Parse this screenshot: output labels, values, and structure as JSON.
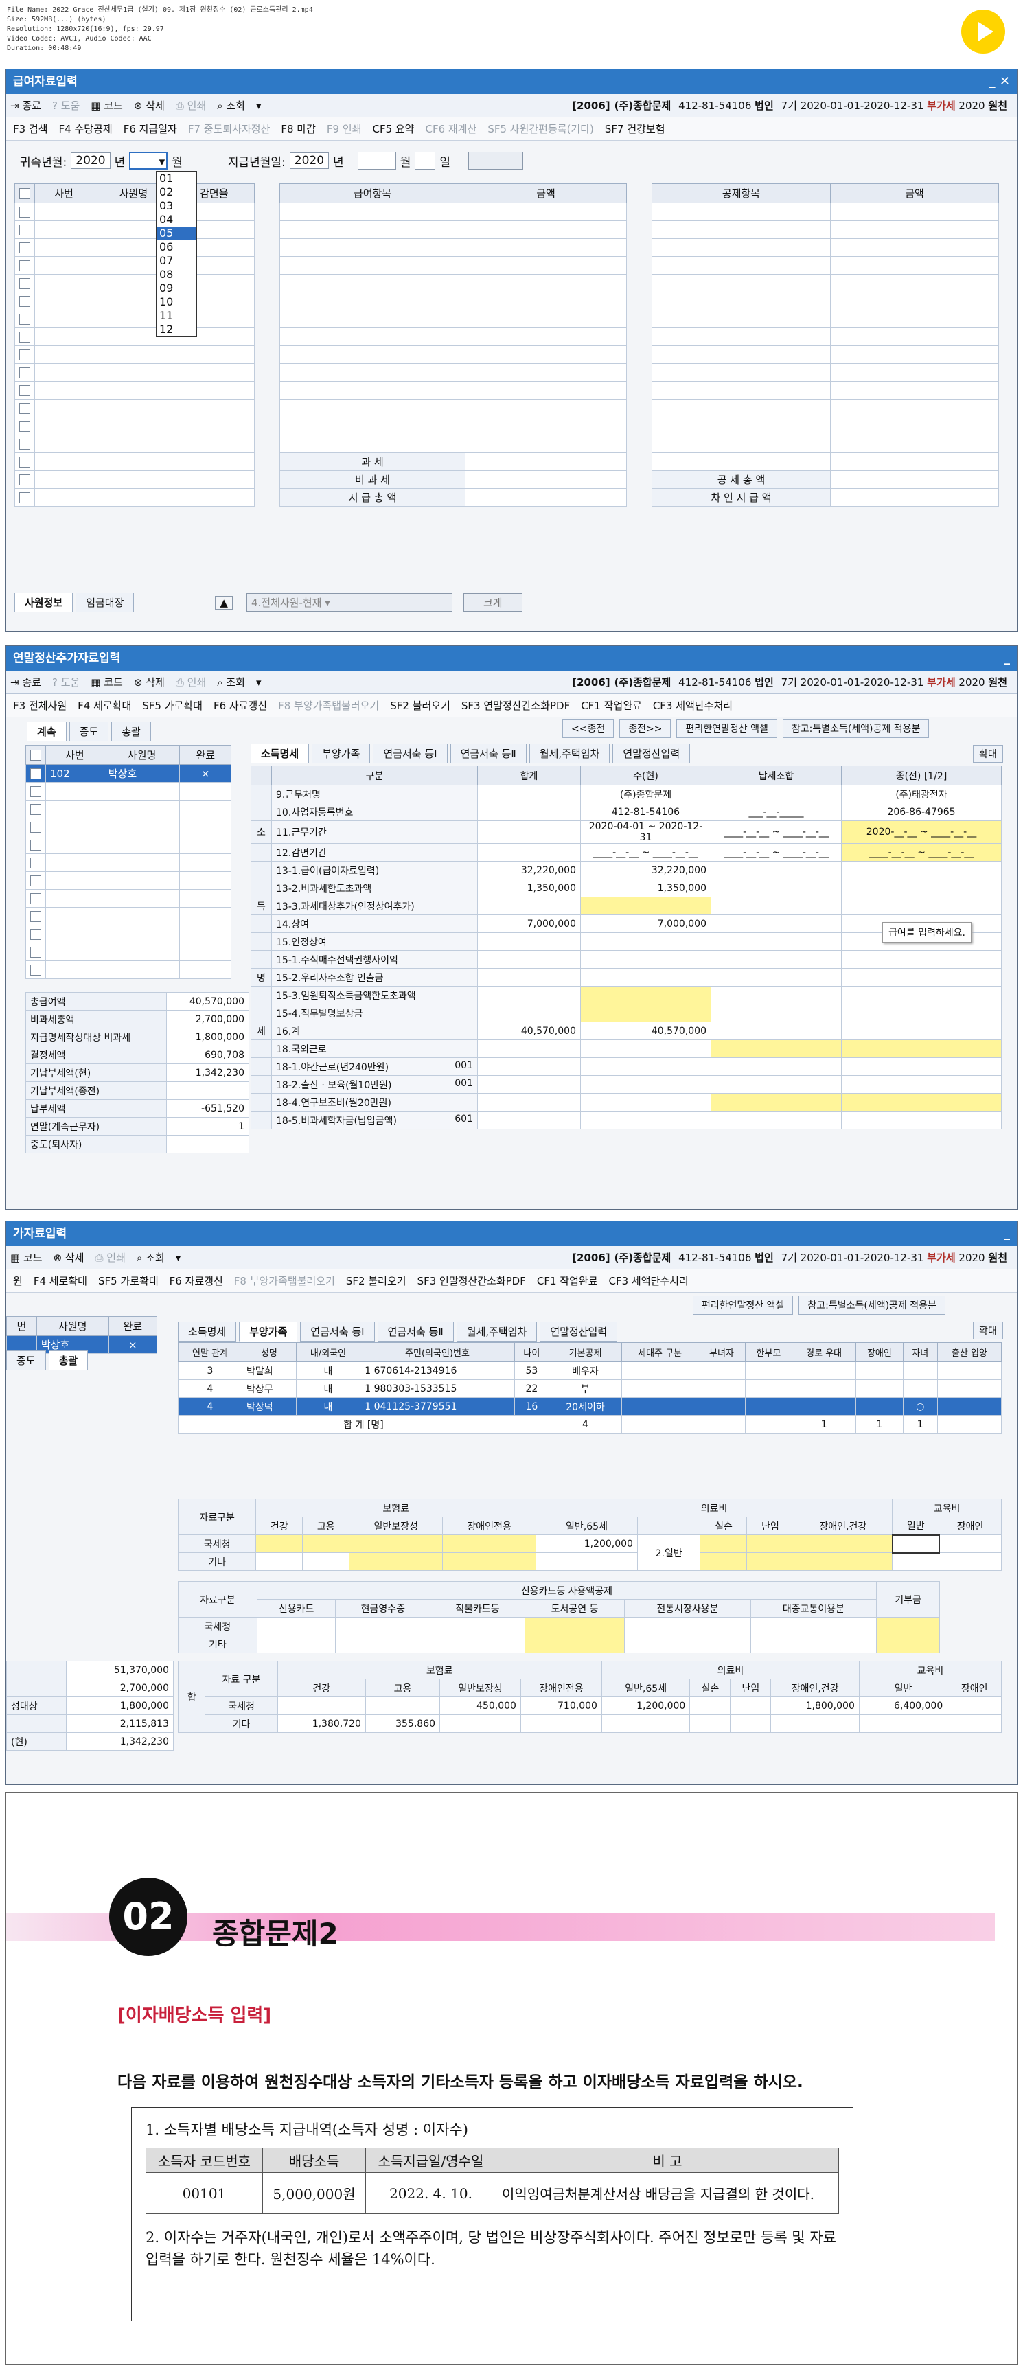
{
  "meta": {
    "lines": [
      "File Name: 2022 Grace 전산세무1급 (실기) 09. 제1장 원천징수 (02) 근로소득관리 2.mp4",
      "Size: 592MB(...) (bytes)",
      "Resolution: 1280x720(16:9), fps: 29.97",
      "Video Codec: AVC1, Audio Codec: AAC",
      "Duration: 00:48:49"
    ]
  },
  "company": {
    "code": "[2006]",
    "name": "(주)종합문제",
    "bizno": "412-81-54106",
    "type": "법인",
    "term": "7기",
    "period": "2020-01-01-2020-12-31",
    "vat": "부가세",
    "year": "2020",
    "tag": "원천"
  },
  "win1": {
    "title": "급여자료입력",
    "toolbar": [
      "종료",
      "도움",
      "코드",
      "삭제",
      "인쇄",
      "조회"
    ],
    "fkeys": [
      "F3 검색",
      "F4 수당공제",
      "F6 지급일자",
      "F7 중도퇴사자정산",
      "F8 마감",
      "F9 인쇄",
      "CF5 요약",
      "CF6 재계산",
      "SF5 사원간편등록(기타)",
      "SF7 건강보험"
    ],
    "attr_label": "귀속년월:",
    "attr_year": "2020",
    "year_unit": "년",
    "month_unit": "월",
    "pay_label": "지급년월일:",
    "pay_year": "2020",
    "day_unit": "일",
    "months": [
      "01",
      "02",
      "03",
      "04",
      "05",
      "06",
      "07",
      "08",
      "09",
      "10",
      "11",
      "12"
    ],
    "selected_month": "05",
    "left_cols": [
      "사번",
      "사원명",
      "감면율"
    ],
    "mid_cols": [
      "급여항목",
      "금액"
    ],
    "right_cols": [
      "공제항목",
      "금액"
    ],
    "mid_totals": [
      "과 세",
      "비 과 세",
      "지 급 총 액"
    ],
    "right_totals": [
      "공 제 총 액",
      "차 인 지 급 액"
    ],
    "bottom_tabs": [
      "사원정보",
      "임금대장"
    ],
    "filter": "4.전체사원-현재",
    "enlarge": "크게"
  },
  "win2": {
    "title": "연말정산추가자료입력",
    "toolbar": [
      "종료",
      "도움",
      "코드",
      "삭제",
      "인쇄",
      "조회"
    ],
    "fkeys": [
      "F3 전체사원",
      "F4 세로확대",
      "SF5 가로확대",
      "F6 자료갱신",
      "F8 부양가족탭불러오기",
      "SF2 불러오기",
      "SF3 연말정산간소화PDF",
      "CF1 작업완료",
      "CF3 세액단수처리"
    ],
    "left_tabs": [
      "계속",
      "중도",
      "총괄"
    ],
    "nav": [
      "<<종전",
      "종전>>",
      "편리한연말정산 액셀",
      "참고:특별소득(세액)공제 적용분"
    ],
    "tabs": [
      "소득명세",
      "부양가족",
      "연금저축 등Ⅰ",
      "연금저축 등Ⅱ",
      "월세,주택임차",
      "연말정산입력"
    ],
    "enlarge": "확대",
    "emp_cols": [
      "사번",
      "사원명",
      "완료"
    ],
    "emp": {
      "no": "102",
      "name": "박상호",
      "done": "×"
    },
    "sum_rows": [
      {
        "label": "총급여액",
        "value": "40,570,000"
      },
      {
        "label": "비과세총액",
        "value": "2,700,000"
      },
      {
        "label": "지급명세작성대상 비과세",
        "value": "1,800,000"
      },
      {
        "label": "결정세액",
        "value": "690,708"
      },
      {
        "label": "기납부세액(현)",
        "value": "1,342,230"
      },
      {
        "label": "기납부세액(종전)",
        "value": ""
      },
      {
        "label": "납부세액",
        "value": "-651,520"
      },
      {
        "label": "연말(계속근무자)",
        "value": "1"
      },
      {
        "label": "중도(퇴사자)",
        "value": ""
      }
    ],
    "cols": [
      "구분",
      "합계",
      "주(현)",
      "납세조합",
      "종(전) [1/2]"
    ],
    "side": [
      "소",
      "득",
      "명",
      "세"
    ],
    "rows": [
      {
        "label": "9.근무처명",
        "sum": "",
        "cur": "(주)종합문제",
        "tax": "",
        "prev": "(주)태광전자"
      },
      {
        "label": "10.사업자등록번호",
        "sum": "",
        "cur": "412-81-54106",
        "tax": "___-__-_____",
        "prev": "206-86-47965"
      },
      {
        "label": "11.근무기간",
        "sum": "",
        "cur": "2020-04-01 ~ 2020-12-31",
        "tax": "____-__-__ ~ ____-__-__",
        "prev": "2020-__-__ ~ ____-__-__"
      },
      {
        "label": "12.감면기간",
        "sum": "",
        "cur": "____-__-__ ~ ____-__-__",
        "tax": "____-__-__ ~ ____-__-__",
        "prev": "____-__-__ ~ ____-__-__"
      },
      {
        "label": "13-1.급여(급여자료입력)",
        "sum": "32,220,000",
        "cur": "32,220,000",
        "tax": "",
        "prev": ""
      },
      {
        "label": "13-2.비과세한도초과액",
        "sum": "1,350,000",
        "cur": "1,350,000",
        "tax": "",
        "prev": ""
      },
      {
        "label": "13-3.과세대상추가(인정상여추가)",
        "sum": "",
        "cur": "",
        "tax": "",
        "prev": ""
      },
      {
        "label": "14.상여",
        "sum": "7,000,000",
        "cur": "7,000,000",
        "tax": "",
        "prev": ""
      },
      {
        "label": "15.인정상여",
        "sum": "",
        "cur": "",
        "tax": "",
        "prev": ""
      },
      {
        "label": "15-1.주식매수선택권행사이익",
        "sum": "",
        "cur": "",
        "tax": "",
        "prev": ""
      },
      {
        "label": "15-2.우리사주조합 인출금",
        "sum": "",
        "cur": "",
        "tax": "",
        "prev": ""
      },
      {
        "label": "15-3.임원퇴직소득금액한도초과액",
        "sum": "",
        "cur": "",
        "tax": "",
        "prev": ""
      },
      {
        "label": "15-4.직무발명보상금",
        "sum": "",
        "cur": "",
        "tax": "",
        "prev": ""
      },
      {
        "label": "16.계",
        "sum": "40,570,000",
        "cur": "40,570,000",
        "tax": "",
        "prev": ""
      },
      {
        "label": "18.국외근로",
        "sum": "",
        "cur": "",
        "tax": "",
        "prev": ""
      },
      {
        "label": "18-1.야간근로(년240만원)",
        "code": "001",
        "sum": "",
        "cur": "",
        "tax": "",
        "prev": ""
      },
      {
        "label": "18-2.출산 · 보육(월10만원)",
        "code": "001",
        "sum": "",
        "cur": "",
        "tax": "",
        "prev": ""
      },
      {
        "label": "18-4.연구보조비(월20만원)",
        "sum": "",
        "cur": "",
        "tax": "",
        "prev": ""
      },
      {
        "label": "18-5.비과세학자금(납입금액)",
        "code": "601",
        "sum": "",
        "cur": "",
        "tax": "",
        "prev": ""
      }
    ],
    "tooltip": "급여를 입력하세요."
  },
  "win3": {
    "title": "가자료입력",
    "toolbar": [
      "코드",
      "삭제",
      "인쇄",
      "조회"
    ],
    "fkeys": [
      "원",
      "F4 세로확대",
      "SF5 가로확대",
      "F6 자료갱신",
      "F8 부양가족탭불러오기",
      "SF2 불러오기",
      "SF3 연말정산간소화PDF",
      "CF1 작업완료",
      "CF3 세액단수처리"
    ],
    "left_cols": [
      "번",
      "사원명",
      "완료"
    ],
    "emp_name": "박상호",
    "emp_done": "×",
    "left_tabs": [
      "중도",
      "총괄"
    ],
    "nav": [
      "편리한연말정산 액셀",
      "참고:특별소득(세액)공제 적용분"
    ],
    "tabs": [
      "소득명세",
      "부양가족",
      "연금저축 등Ⅰ",
      "연금저축 등Ⅱ",
      "월세,주택임차",
      "연말정산입력"
    ],
    "enlarge": "확대",
    "dep_cols": [
      "연말 관계",
      "성명",
      "내/외국인",
      "주민(외국인)번호",
      "나이",
      "기본공제",
      "세대주 구분",
      "부녀자",
      "한부모",
      "경로 우대",
      "장애인",
      "자녀",
      "출산 입양"
    ],
    "deps": [
      {
        "rel": "3",
        "name": "박말희",
        "nat": "내",
        "natcode": "1",
        "id": "670614-2134916",
        "age": "53",
        "basic": "배우자",
        "dis": "",
        "child": ""
      },
      {
        "rel": "4",
        "name": "박상무",
        "nat": "내",
        "natcode": "1",
        "id": "980303-1533515",
        "age": "22",
        "basic": "부",
        "dis": "",
        "child": ""
      },
      {
        "rel": "4",
        "name": "박상덕",
        "nat": "내",
        "natcode": "1",
        "id": "041125-3779551",
        "age": "16",
        "basic": "20세이하",
        "dis": "",
        "child": "○"
      }
    ],
    "total_label": "합 계 [명]",
    "totals": {
      "basic": "4",
      "c1": "1",
      "c2": "1",
      "c3": "1"
    },
    "ins_header": "보험료",
    "med_header": "의료비",
    "edu_header": "교육비",
    "src_label": "자료구분",
    "ins_cols": [
      "건강",
      "고용",
      "일반보장성",
      "장애인전용"
    ],
    "med_cols": [
      "일반,65세",
      "실손",
      "난임",
      "장애인,건강"
    ],
    "edu_cols": [
      "일반",
      "장애인"
    ],
    "rows": [
      "국세청",
      "기타"
    ],
    "med_general": "1,200,000",
    "general_tag": "2.일반",
    "card_header": "신용카드등 사용액공제",
    "card_cols": [
      "신용카드",
      "현금영수증",
      "직불카드등",
      "도서공연 등",
      "전통시장사용분",
      "대중교통이용분"
    ],
    "donation": "기부금",
    "sum_label": "합",
    "sum_row_label": "자료 구분",
    "nts": {
      "ins3": "450,000",
      "ins4": "710,000",
      "med1": "1,200,000",
      "med4": "1,800,000",
      "edu1": "6,400,000"
    },
    "etc": {
      "ins1": "1,380,720",
      "ins2": "355,860"
    },
    "left_vals": [
      "51,370,000",
      "2,700,000",
      "1,800,000",
      "2,115,813",
      "1,342,230"
    ],
    "left_labels": [
      "",
      "",
      "성대상",
      "",
      "(현)"
    ]
  },
  "doc": {
    "badge": "02",
    "title": "종합문제2",
    "section": "[이자배당소득 입력]",
    "intro": "다음 자료를 이용하여 원천징수대상 소득자의 기타소득자 등록을 하고 이자배당소득 자료입력을 하시오.",
    "item1": "1. 소득자별 배당소득 지급내역(소득자 성명 : 이자수)",
    "cols": [
      "소득자 코드번호",
      "배당소득",
      "소득지급일/영수일",
      "비 고"
    ],
    "row": [
      "00101",
      "5,000,000원",
      "2022. 4. 10.",
      "이익잉여금처분계산서상 배당금을 지급결의 한 것이다."
    ],
    "item2": "2. 이자수는 거주자(내국인, 개인)로서 소액주주이며, 당 법인은 비상장주식회사이다. 주어진 정보로만 등록 및 자료입력을 하기로 한다. 원천징수 세율은 14%이다."
  }
}
